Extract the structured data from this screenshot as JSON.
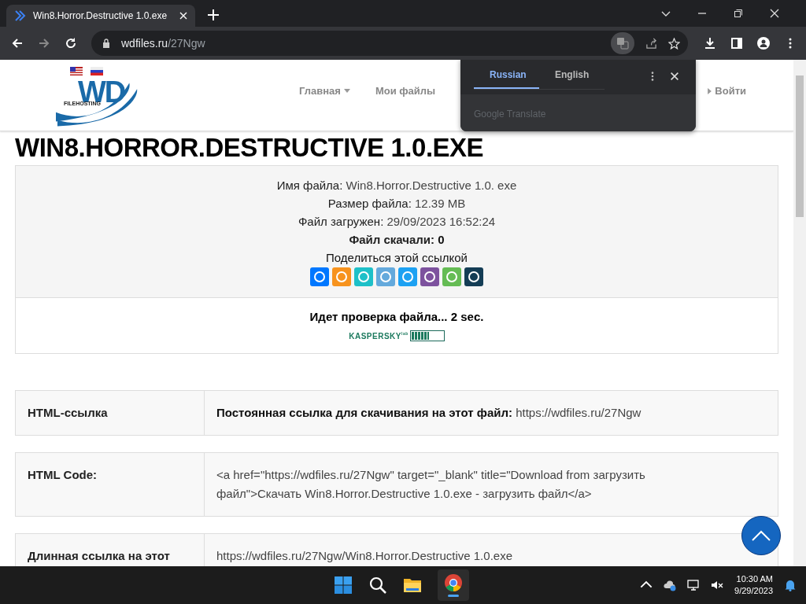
{
  "browser": {
    "tab": {
      "title": "Win8.Horror.Destructive 1.0.exe",
      "selected": true
    },
    "address": {
      "host": "wdfiles.ru",
      "path": "/27Ngw"
    }
  },
  "site": {
    "logo": {
      "mark": "WD",
      "sub": "FILEHOSTING"
    },
    "nav": [
      {
        "label": "Главная",
        "kind": "dropdown"
      },
      {
        "label": "Мои файлы",
        "kind": "link"
      },
      {
        "label": "Войти",
        "kind": "login"
      }
    ]
  },
  "translate_popup": {
    "tabs": [
      {
        "label": "Russian",
        "selected": true
      },
      {
        "label": "English",
        "selected": false
      }
    ],
    "footer": "Google Translate"
  },
  "file": {
    "title": "WIN8.HORROR.DESTRUCTIVE 1.0.EXE",
    "info": [
      {
        "label": "Имя файла:",
        "value": "Win8.Horror.Destructive 1.0. exe",
        "bold": false
      },
      {
        "label": "Размер файла:",
        "value": "12.39 MB",
        "bold": false
      },
      {
        "label": "Файл загружен:",
        "value": "29/09/2023 16:52:24",
        "bold": false
      },
      {
        "label": "Файл скачали:",
        "value": "0",
        "bold": true
      }
    ],
    "share_label": "Поделиться этой ссылкой",
    "share": [
      {
        "color": "#0077ff"
      },
      {
        "color": "#f7931e"
      },
      {
        "color": "#1ec0c8"
      },
      {
        "color": "#64a9dc"
      },
      {
        "color": "#1da1f2"
      },
      {
        "color": "#7d529e"
      },
      {
        "color": "#65bc54"
      },
      {
        "color": "#143d55"
      }
    ],
    "check": {
      "text": "Идет проверка файла... 2 sec.",
      "brand": "KASPERSKY",
      "brand_sub": "lab",
      "level": 0.55
    }
  },
  "links": [
    {
      "label": "HTML-ссылка",
      "content": "**Постоянная ссылка для скачивания на этот файл:** https://wdfiles.ru/27Ngw"
    },
    {
      "label": "HTML Code:",
      "content": "<a href=\"https://wdfiles.ru/27Ngw\" target=\"_blank\" title=\"Download from загрузить файл\">Скачать Win8.Horror.Destructive 1.0.exe - загрузить файл</a>"
    },
    {
      "label": "Длинная ссылка на этот",
      "content": "https://wdfiles.ru/27Ngw/Win8.Horror.Destructive 1.0.exe"
    }
  ],
  "taskbar": {
    "time": "10:30 AM",
    "date": "9/29/2023"
  }
}
